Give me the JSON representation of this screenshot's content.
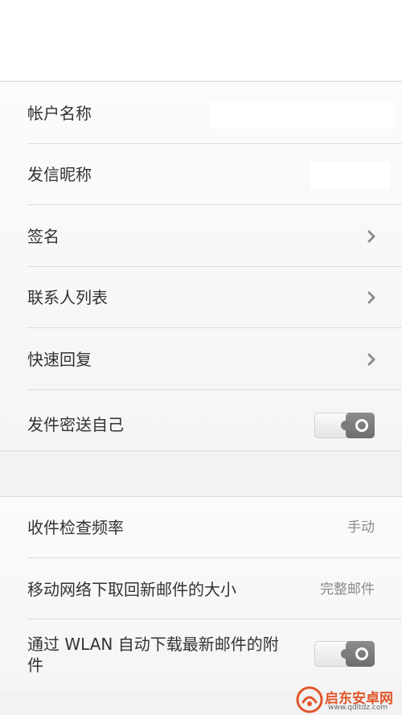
{
  "account_section": {
    "account_name_label": "帐户名称",
    "account_name_value": "",
    "sender_nickname_label": "发信昵称",
    "sender_nickname_value": "",
    "signature_label": "签名",
    "contact_list_label": "联系人列表",
    "quick_reply_label": "快速回复",
    "bcc_self_label": "发件密送自己",
    "bcc_self_enabled": false
  },
  "sync_section": {
    "check_frequency_label": "收件检查频率",
    "check_frequency_value": "手动",
    "mobile_download_size_label": "移动网络下取回新邮件的大小",
    "mobile_download_size_value": "完整邮件",
    "wlan_auto_download_label_line1": "通过 WLAN 自动下载最新邮件的附",
    "wlan_auto_download_label_line2": "件",
    "wlan_auto_download_enabled": false
  },
  "icons": {
    "chevron": "chevron-right-icon",
    "toggle": "toggle-switch"
  },
  "colors": {
    "background": "#f2f2f2",
    "row_background": "#fafafa",
    "text_primary": "#333333",
    "text_secondary": "#8a8a8a",
    "toggle_knob": "#7a7a7a",
    "watermark_accent": "#e0562a"
  },
  "watermark": {
    "name": "启东安卓网",
    "url": "www.qdltdz.com"
  }
}
